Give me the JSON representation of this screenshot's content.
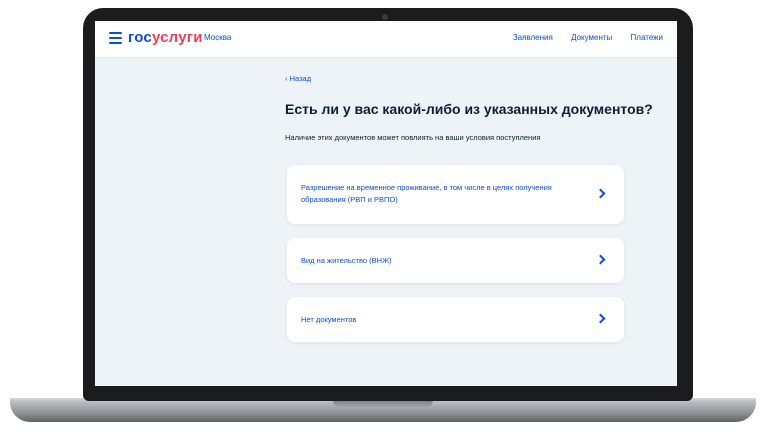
{
  "header": {
    "logo_part1": "гос",
    "logo_part2": "услуги",
    "city": "Москва",
    "nav": [
      "Заявления",
      "Документы",
      "Платежи"
    ]
  },
  "main": {
    "back_label": "‹ Назад",
    "title": "Есть ли у вас какой-либо из указанных документов?",
    "subtitle": "Наличие этих документов может повлиять на ваши условия поступления",
    "options": [
      {
        "label": "Разрешение на временное проживание, в том числе в целях получения образования (РВП и РВПО)"
      },
      {
        "label": "Вид на жительство (ВНЖ)"
      },
      {
        "label": "Нет документов"
      }
    ]
  },
  "colors": {
    "accent": "#0d4cd3",
    "brand_red": "#ee3f58",
    "background": "#eef3f8"
  },
  "icons": [
    "menu-icon",
    "chevron-right-icon"
  ]
}
